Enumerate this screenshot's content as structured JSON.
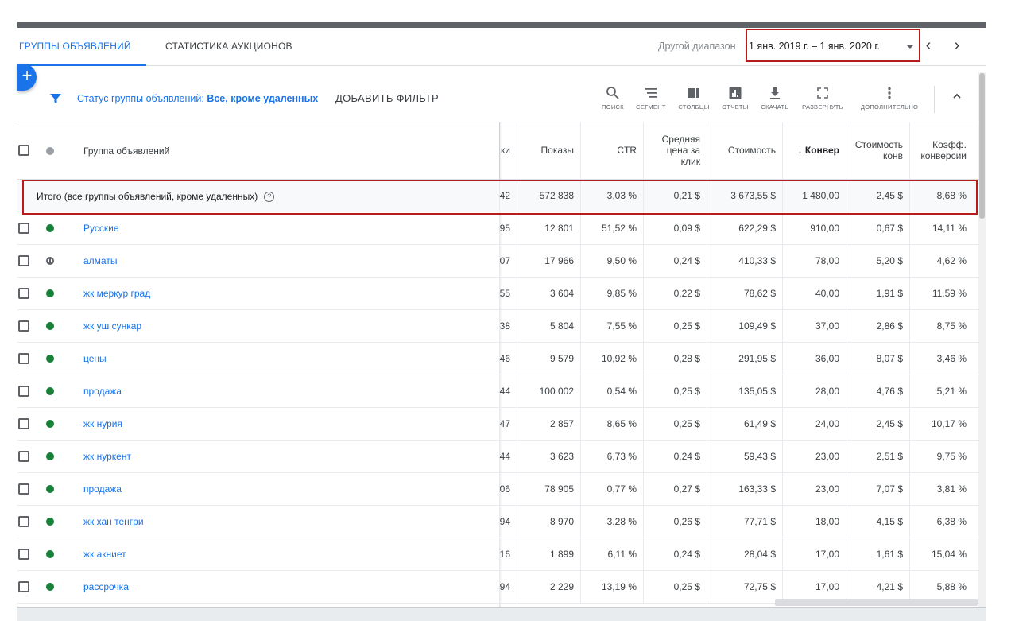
{
  "tabs": {
    "active": "ГРУППЫ ОБЪЯВЛЕНИЙ",
    "inactive": "СТАТИСТИКА АУКЦИОНОВ"
  },
  "date_range": {
    "label": "Другой диапазон",
    "value": "1 янв. 2019 г. – 1 янв. 2020 г."
  },
  "nav": {
    "prev": "‹",
    "next": "›"
  },
  "fab": "+",
  "filter": {
    "label": "Статус группы объявлений:",
    "value": "Все, кроме удаленных",
    "add": "ДОБАВИТЬ ФИЛЬТР"
  },
  "toolbar": [
    {
      "label": "ПОИСК",
      "icon": "search-icon"
    },
    {
      "label": "СЕГМЕНТ",
      "icon": "segment-icon"
    },
    {
      "label": "СТОЛБЦЫ",
      "icon": "columns-icon"
    },
    {
      "label": "ОТЧЕТЫ",
      "icon": "reports-icon"
    },
    {
      "label": "СКАЧАТЬ",
      "icon": "download-icon"
    },
    {
      "label": "РАЗВЕРНУТЬ",
      "icon": "expand-icon"
    },
    {
      "label": "ДОПОЛНИТЕЛЬНО",
      "icon": "more-icon"
    }
  ],
  "collapse": "^",
  "columns": {
    "name": "Группа объявлений",
    "partial": "ки",
    "impressions": "Показы",
    "ctr": "CTR",
    "avg_cpc": "Средняя цена за клик",
    "cost": "Стоимость",
    "conversions": "↓ Конвер",
    "cost_per_conv": "Стоимость конв",
    "conv_rate": "Коэфф. конверсии"
  },
  "total": {
    "label": "Итого (все группы объявлений, кроме удаленных)",
    "help": "?",
    "partial": "42",
    "impressions": "572 838",
    "ctr": "3,03 %",
    "avg_cpc": "0,21 $",
    "cost": "3 673,55 $",
    "conversions": "1 480,00",
    "cost_per_conv": "2,45 $",
    "conv_rate": "8,68 %"
  },
  "rows": [
    {
      "name": "Русские",
      "status": "green",
      "partial": "95",
      "impressions": "12 801",
      "ctr": "51,52 %",
      "avg_cpc": "0,09 $",
      "cost": "622,29 $",
      "conversions": "910,00",
      "cost_per_conv": "0,67 $",
      "conv_rate": "14,11 %"
    },
    {
      "name": "алматы",
      "status": "paused",
      "partial": "07",
      "impressions": "17 966",
      "ctr": "9,50 %",
      "avg_cpc": "0,24 $",
      "cost": "410,33 $",
      "conversions": "78,00",
      "cost_per_conv": "5,20 $",
      "conv_rate": "4,62 %"
    },
    {
      "name": "жк меркур град",
      "status": "green",
      "partial": "55",
      "impressions": "3 604",
      "ctr": "9,85 %",
      "avg_cpc": "0,22 $",
      "cost": "78,62 $",
      "conversions": "40,00",
      "cost_per_conv": "1,91 $",
      "conv_rate": "11,59 %"
    },
    {
      "name": "жк уш сункар",
      "status": "green",
      "partial": "38",
      "impressions": "5 804",
      "ctr": "7,55 %",
      "avg_cpc": "0,25 $",
      "cost": "109,49 $",
      "conversions": "37,00",
      "cost_per_conv": "2,86 $",
      "conv_rate": "8,75 %"
    },
    {
      "name": "цены",
      "status": "green",
      "partial": "46",
      "impressions": "9 579",
      "ctr": "10,92 %",
      "avg_cpc": "0,28 $",
      "cost": "291,95 $",
      "conversions": "36,00",
      "cost_per_conv": "8,07 $",
      "conv_rate": "3,46 %"
    },
    {
      "name": "продажа",
      "status": "green",
      "partial": "44",
      "impressions": "100 002",
      "ctr": "0,54 %",
      "avg_cpc": "0,25 $",
      "cost": "135,05 $",
      "conversions": "28,00",
      "cost_per_conv": "4,76 $",
      "conv_rate": "5,21 %"
    },
    {
      "name": "жк нурия",
      "status": "green",
      "partial": "47",
      "impressions": "2 857",
      "ctr": "8,65 %",
      "avg_cpc": "0,25 $",
      "cost": "61,49 $",
      "conversions": "24,00",
      "cost_per_conv": "2,45 $",
      "conv_rate": "10,17 %"
    },
    {
      "name": "жк нуркент",
      "status": "green",
      "partial": "44",
      "impressions": "3 623",
      "ctr": "6,73 %",
      "avg_cpc": "0,24 $",
      "cost": "59,43 $",
      "conversions": "23,00",
      "cost_per_conv": "2,51 $",
      "conv_rate": "9,75 %"
    },
    {
      "name": "продажа",
      "status": "green",
      "partial": "06",
      "impressions": "78 905",
      "ctr": "0,77 %",
      "avg_cpc": "0,27 $",
      "cost": "163,33 $",
      "conversions": "23,00",
      "cost_per_conv": "7,07 $",
      "conv_rate": "3,81 %"
    },
    {
      "name": "жк хан тенгри",
      "status": "green",
      "partial": "94",
      "impressions": "8 970",
      "ctr": "3,28 %",
      "avg_cpc": "0,26 $",
      "cost": "77,71 $",
      "conversions": "18,00",
      "cost_per_conv": "4,15 $",
      "conv_rate": "6,38 %"
    },
    {
      "name": "жк акниет",
      "status": "green",
      "partial": "16",
      "impressions": "1 899",
      "ctr": "6,11 %",
      "avg_cpc": "0,24 $",
      "cost": "28,04 $",
      "conversions": "17,00",
      "cost_per_conv": "1,61 $",
      "conv_rate": "15,04 %"
    },
    {
      "name": "рассрочка",
      "status": "green",
      "partial": "94",
      "impressions": "2 229",
      "ctr": "13,19 %",
      "avg_cpc": "0,25 $",
      "cost": "72,75 $",
      "conversions": "17,00",
      "cost_per_conv": "4,21 $",
      "conv_rate": "5,88 %"
    }
  ],
  "colors": {
    "accent": "#1a73e8",
    "highlight_box": "#b71c1c",
    "status_active": "#188038",
    "status_paused": "#5f6368"
  }
}
